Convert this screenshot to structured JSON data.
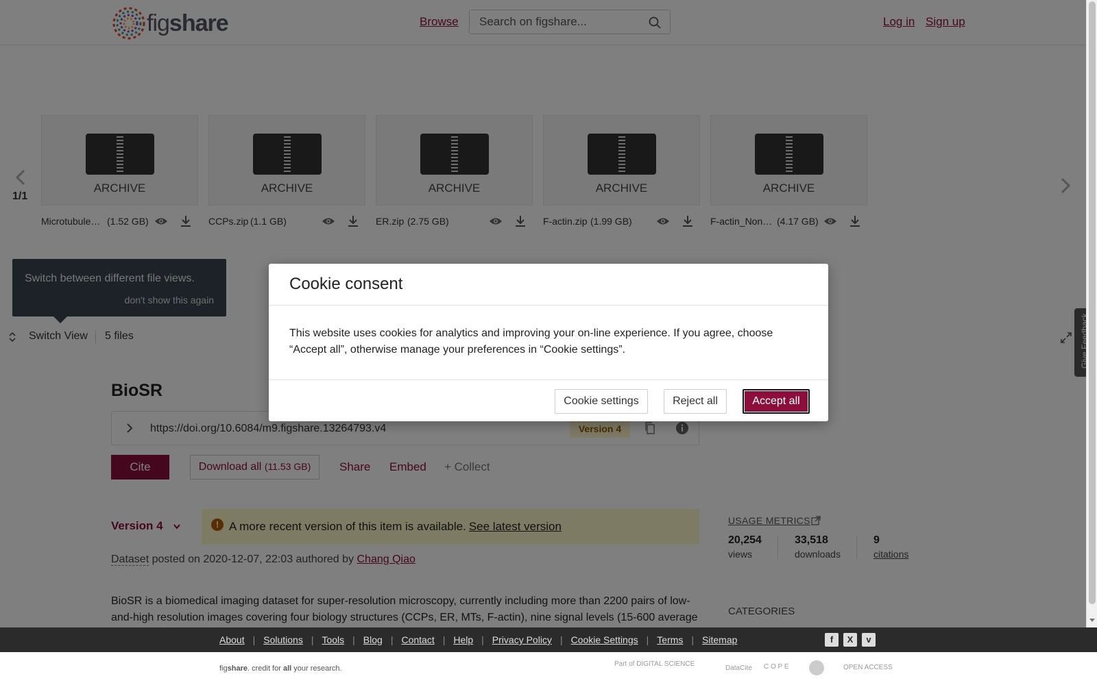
{
  "header": {
    "logo_text_thin": "fig",
    "logo_text_bold": "share",
    "browse_label": "Browse",
    "search_placeholder": "Search on figshare...",
    "login_label": "Log in",
    "signup_label": "Sign up"
  },
  "carousel": {
    "page_indicator": "1/1",
    "files": [
      {
        "type_label": "ARCHIVE",
        "name": "Microtubule…",
        "size": "(1.52 GB)"
      },
      {
        "type_label": "ARCHIVE",
        "name": "CCPs.zip",
        "size": "(1.1 GB)"
      },
      {
        "type_label": "ARCHIVE",
        "name": "ER.zip",
        "size": "(2.75 GB)"
      },
      {
        "type_label": "ARCHIVE",
        "name": "F-actin.zip",
        "size": "(1.99 GB)"
      },
      {
        "type_label": "ARCHIVE",
        "name": "F-actin_Non…",
        "size": "(4.17 GB)"
      }
    ]
  },
  "tooltip": {
    "text": "Switch between different file views.",
    "dismiss": "don't show this again"
  },
  "toolbar": {
    "switch_view_label": "Switch View",
    "files_count": "5 files"
  },
  "item": {
    "title": "BioSR",
    "doi": "https://doi.org/10.6084/m9.figshare.13264793.v4",
    "version_badge": "Version 4",
    "cite_label": "Cite",
    "download_all_label": "Download all",
    "download_all_size": "(11.53 GB)",
    "share_label": "Share",
    "embed_label": "Embed",
    "collect_label": "+ Collect",
    "version_select": "Version 4",
    "notice_text": "A more recent version of this item is available.",
    "notice_link": "See latest version",
    "item_type": "Dataset",
    "posted_text": " posted on 2020-12-07, 22:03 authored by ",
    "author": "Chang Qiao",
    "description": "BioSR is a biomedical imaging dataset for super-resolution microscopy, currently including more than 2200 pairs of low-and-high resolution images covering four biology structures (CCPs, ER, MTs, F-actin), nine signal levels (15-600 average"
  },
  "sidebar": {
    "metrics_title": "USAGE METRICS",
    "views_num": "20,254",
    "views_label": "views",
    "downloads_num": "33,518",
    "downloads_label": "downloads",
    "citations_num": "9",
    "citations_label": "citations",
    "categories_title": "CATEGORIES"
  },
  "feedback_label": "Give Feedback",
  "footer": {
    "links": [
      "About",
      "Solutions",
      "Tools",
      "Blog",
      "Contact",
      "Help",
      "Privacy Policy",
      "Cookie Settings",
      "Terms",
      "Sitemap"
    ],
    "social": [
      "f",
      "X",
      "v"
    ],
    "tagline_pre": "fig",
    "tagline_bold": "share",
    "tagline_mid": ". credit for ",
    "tagline_all": "all",
    "tagline_end": " your research.",
    "partner_digital": "Part of DIGITAL SCIENCE",
    "partner_datacite": "DataCite",
    "partner_cope": "C O P E",
    "partner_oa": "OPEN ACCESS"
  },
  "cookie_modal": {
    "title": "Cookie consent",
    "body": "This website uses cookies for analytics and improving your on-line experience. If you agree, choose “Accept all”, otherwise manage your preferences in “Cookie settings”.",
    "settings_label": "Cookie settings",
    "reject_label": "Reject all",
    "accept_label": "Accept all"
  },
  "colors": {
    "brand": "#8a0f3b",
    "notice_bg": "#fdf6c9",
    "footer_bg": "#2b2b2b"
  }
}
